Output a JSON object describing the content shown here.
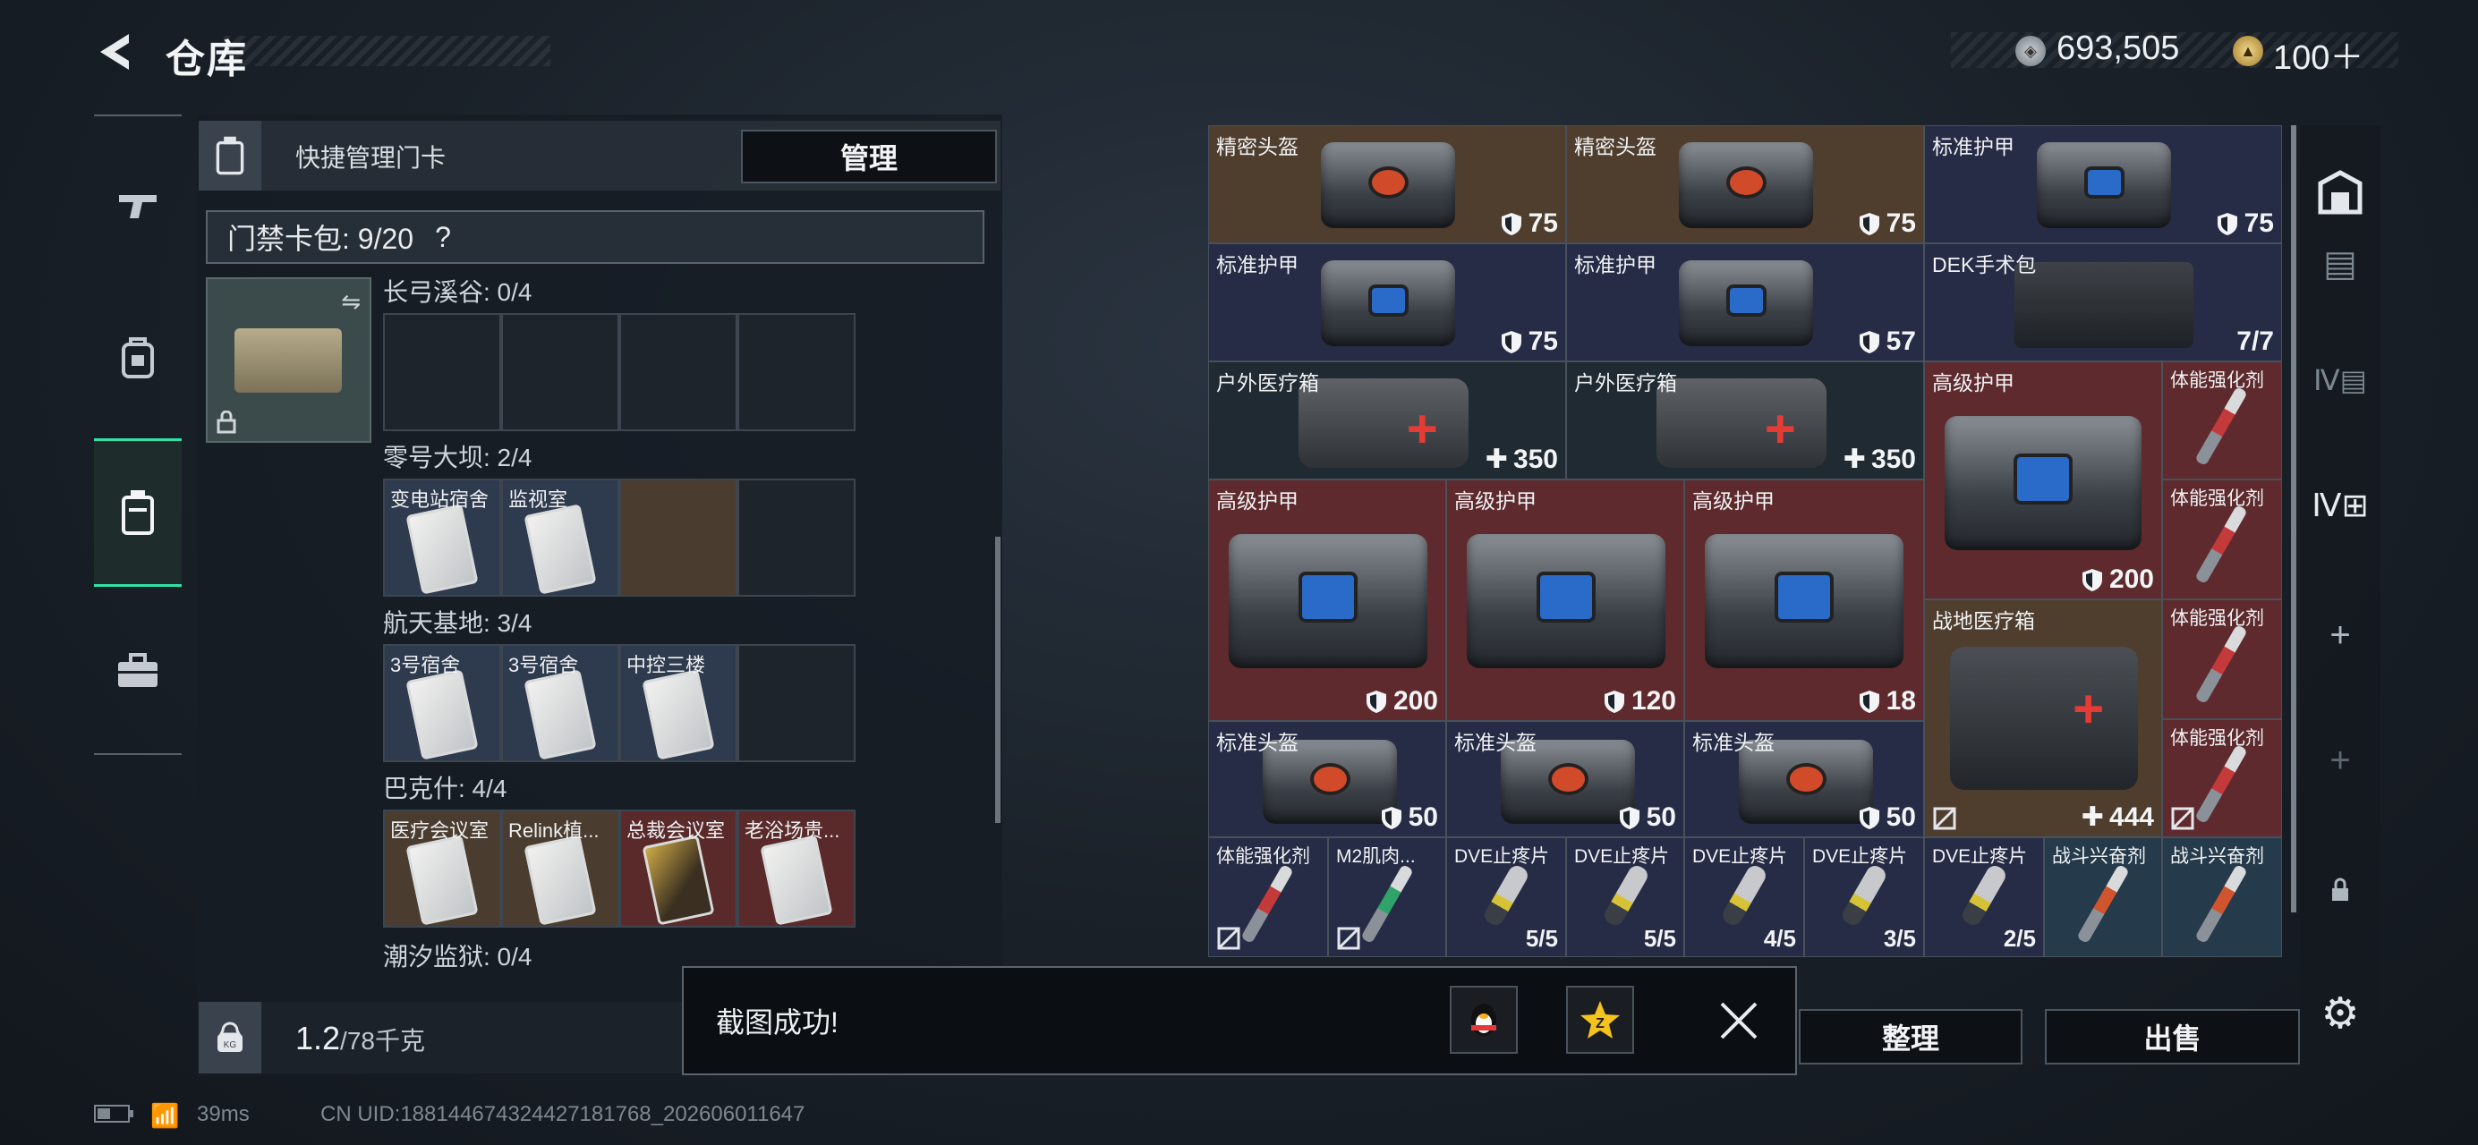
{
  "header": {
    "title": "仓库",
    "currency_silver": "693,505",
    "currency_gold": "100＋"
  },
  "left_panel": {
    "title": "快捷管理门卡",
    "manage_button": "管理",
    "card_pack_label": "门禁卡包: 9/20",
    "help": "?",
    "sections": [
      {
        "title": "长弓溪谷: 0/4",
        "slots": [
          {
            "label": ""
          },
          {
            "label": ""
          },
          {
            "label": ""
          },
          {
            "label": ""
          }
        ]
      },
      {
        "title": "零号大坝: 2/4",
        "slots": [
          {
            "label": "变电站宿舍"
          },
          {
            "label": "监视室"
          },
          {
            "label": ""
          },
          {
            "label": ""
          }
        ]
      },
      {
        "title": "航天基地: 3/4",
        "slots": [
          {
            "label": "3号宿舍"
          },
          {
            "label": "3号宿舍"
          },
          {
            "label": "中控三楼"
          },
          {
            "label": ""
          }
        ]
      },
      {
        "title": "巴克什: 4/4",
        "slots": [
          {
            "label": "医疗会议室"
          },
          {
            "label": "Relink植..."
          },
          {
            "label": "总裁会议室"
          },
          {
            "label": "老浴场贵..."
          }
        ]
      },
      {
        "title": "潮汐监狱: 0/4",
        "slots": []
      }
    ],
    "weight_value": "1.2",
    "weight_max": "/78千克"
  },
  "grid": {
    "cells": [
      {
        "label": "精密头盔",
        "value": "75"
      },
      {
        "label": "精密头盔",
        "value": "75"
      },
      {
        "label": "标准护甲",
        "value": "75"
      },
      {
        "label": "标准护甲",
        "value": "75"
      },
      {
        "label": "标准护甲",
        "value": "57"
      },
      {
        "label": "DEK手术包",
        "value": "7/7"
      },
      {
        "label": "户外医疗箱",
        "value": "350"
      },
      {
        "label": "户外医疗箱",
        "value": "350"
      },
      {
        "label": "高级护甲",
        "value": "200"
      },
      {
        "label": "体能强化剂",
        "value": ""
      },
      {
        "label": "高级护甲",
        "value": "200"
      },
      {
        "label": "高级护甲",
        "value": "120"
      },
      {
        "label": "高级护甲",
        "value": "18"
      },
      {
        "label": "体能强化剂",
        "value": ""
      },
      {
        "label": "战地医疗箱",
        "value": "444"
      },
      {
        "label": "体能强化剂",
        "value": ""
      },
      {
        "label": "标准头盔",
        "value": "50"
      },
      {
        "label": "标准头盔",
        "value": "50"
      },
      {
        "label": "标准头盔",
        "value": "50"
      },
      {
        "label": "体能强化剂",
        "value": ""
      },
      {
        "label": "体能强化剂",
        "value": ""
      },
      {
        "label": "M2肌肉...",
        "value": ""
      },
      {
        "label": "DVE止疼片",
        "value": "5/5"
      },
      {
        "label": "DVE止疼片",
        "value": "5/5"
      },
      {
        "label": "DVE止疼片",
        "value": "4/5"
      },
      {
        "label": "DVE止疼片",
        "value": "3/5"
      },
      {
        "label": "DVE止疼片",
        "value": "2/5"
      },
      {
        "label": "战斗兴奋剂",
        "value": ""
      },
      {
        "label": "战斗兴奋剂",
        "value": ""
      }
    ]
  },
  "bottom_buttons": {
    "sort": "整理",
    "sell": "出售"
  },
  "toast": {
    "message": "截图成功!"
  },
  "status_bar": {
    "ping": "39ms",
    "uid": "CN UID:1881446743244271817​68_202606011647"
  }
}
